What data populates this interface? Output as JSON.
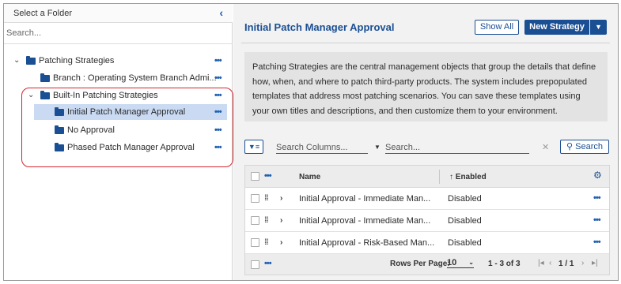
{
  "left_panel": {
    "header": "Select a Folder",
    "search_placeholder": "Search...",
    "tree": {
      "root": {
        "label": "Patching Strategies",
        "more": "•••"
      },
      "branch": {
        "label": "Branch : Operating System Branch Admi...",
        "more": "•••"
      },
      "builtin": {
        "label": "Built-In Patching Strategies",
        "more": "•••"
      },
      "children": [
        {
          "label": "Initial Patch Manager Approval",
          "more": "•••",
          "selected": true
        },
        {
          "label": "No Approval",
          "more": "•••",
          "selected": false
        },
        {
          "label": "Phased Patch Manager Approval",
          "more": "•••",
          "selected": false
        }
      ]
    }
  },
  "main": {
    "title": "Initial Patch Manager Approval",
    "show_all_label": "Show All",
    "new_strategy_label": "New Strategy",
    "description": "Patching Strategies are the central management objects that group the details that define how, when, and where to patch third-party products. The system includes prepopulated templates that address most patching scenarios. You can save these templates using your own titles and descriptions, and then customize them to your environment.",
    "filter": {
      "columns_placeholder": "Search Columns...",
      "search_placeholder": "Search...",
      "search_button": "Search"
    },
    "grid": {
      "header_more": "•••",
      "columns": [
        "Name",
        "Enabled"
      ],
      "sort_indicator": "↑",
      "rows": [
        {
          "name": "Initial Approval - Immediate Man...",
          "enabled": "Disabled"
        },
        {
          "name": "Initial Approval - Immediate Man...",
          "enabled": "Disabled"
        },
        {
          "name": "Initial Approval - Risk-Based Man...",
          "enabled": "Disabled"
        }
      ],
      "footer": {
        "more": "•••",
        "rows_per_page_label": "Rows Per Page:",
        "rows_per_page": "10",
        "range": "1 - 3 of 3",
        "page": "1 / 1"
      }
    }
  },
  "colors": {
    "accent": "#1b4f93",
    "selection": "#c9daf2",
    "highlight_outline": "#d2262c"
  }
}
